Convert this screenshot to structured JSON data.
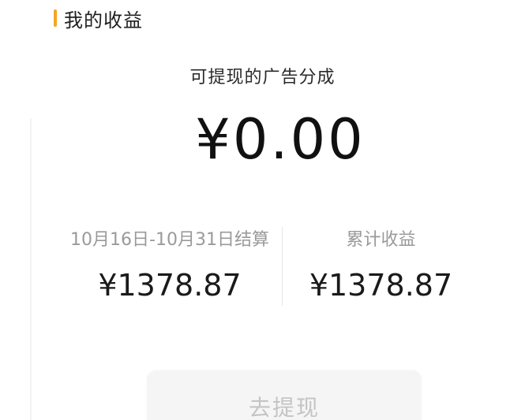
{
  "header": {
    "title": "我的收益"
  },
  "available": {
    "label": "可提现的广告分成",
    "amount": "¥0.00"
  },
  "stats": {
    "period_label": "10月16日-10月31日结算",
    "period_value": "¥1378.87",
    "total_label": "累计收益",
    "total_value": "¥1378.87"
  },
  "actions": {
    "withdraw_label": "去提现"
  },
  "colors": {
    "accent": "#f5a623",
    "disabled_text": "#c4c4c4",
    "muted_text": "#9a9a9a"
  }
}
